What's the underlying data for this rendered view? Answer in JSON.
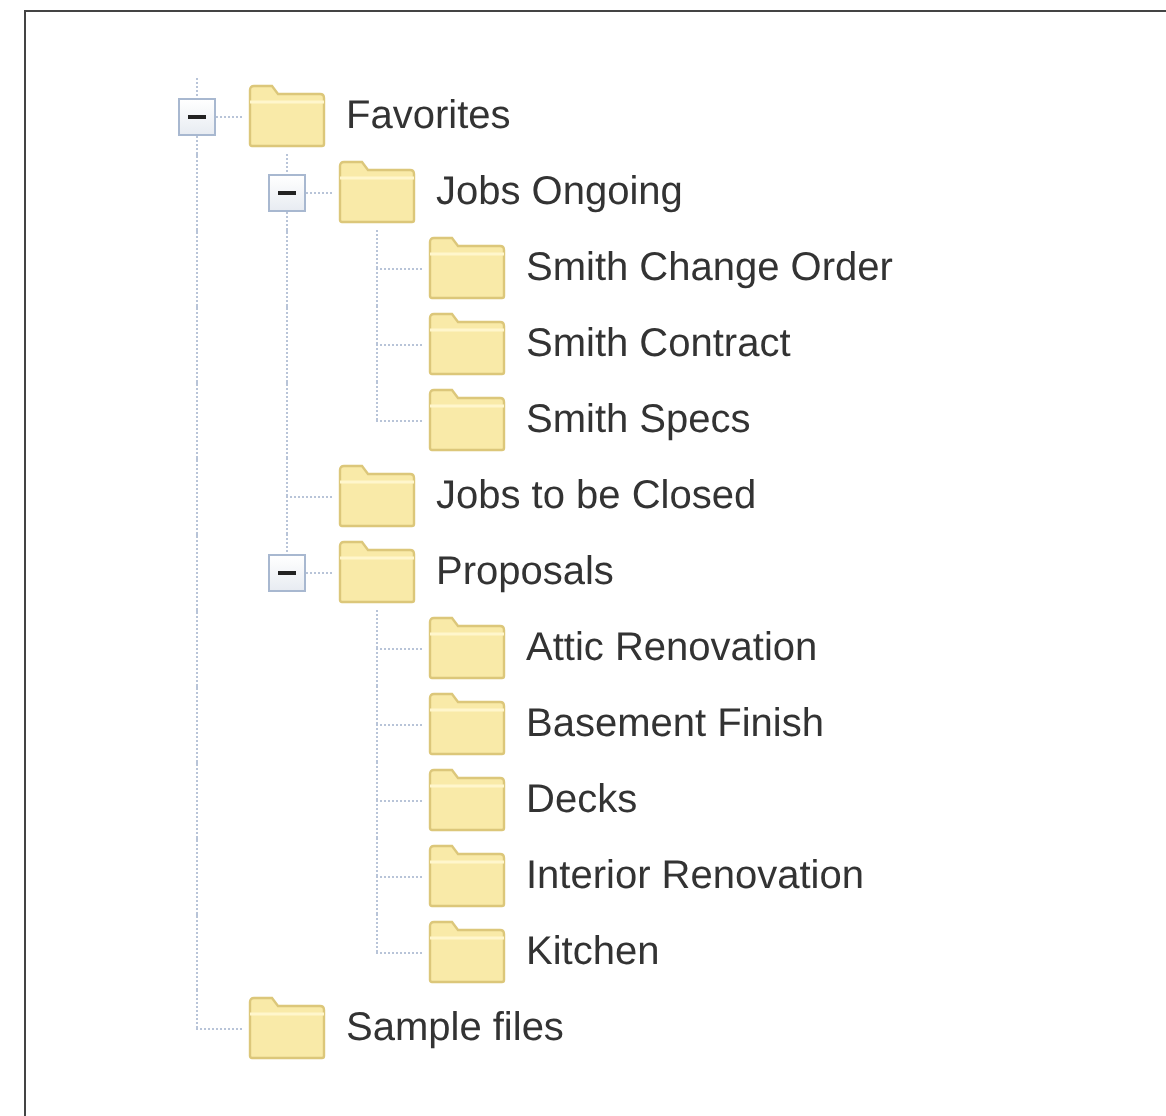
{
  "tree": [
    {
      "label": "Favorites",
      "expanded": true,
      "children": [
        {
          "label": "Jobs Ongoing",
          "expanded": true,
          "children": [
            {
              "label": "Smith Change Order"
            },
            {
              "label": "Smith Contract"
            },
            {
              "label": "Smith Specs"
            }
          ]
        },
        {
          "label": "Jobs to be Closed"
        },
        {
          "label": "Proposals",
          "expanded": true,
          "children": [
            {
              "label": "Attic Renovation"
            },
            {
              "label": "Basement Finish"
            },
            {
              "label": "Decks"
            },
            {
              "label": "Interior Renovation"
            },
            {
              "label": "Kitchen"
            }
          ]
        }
      ]
    },
    {
      "label": "Sample files"
    }
  ]
}
